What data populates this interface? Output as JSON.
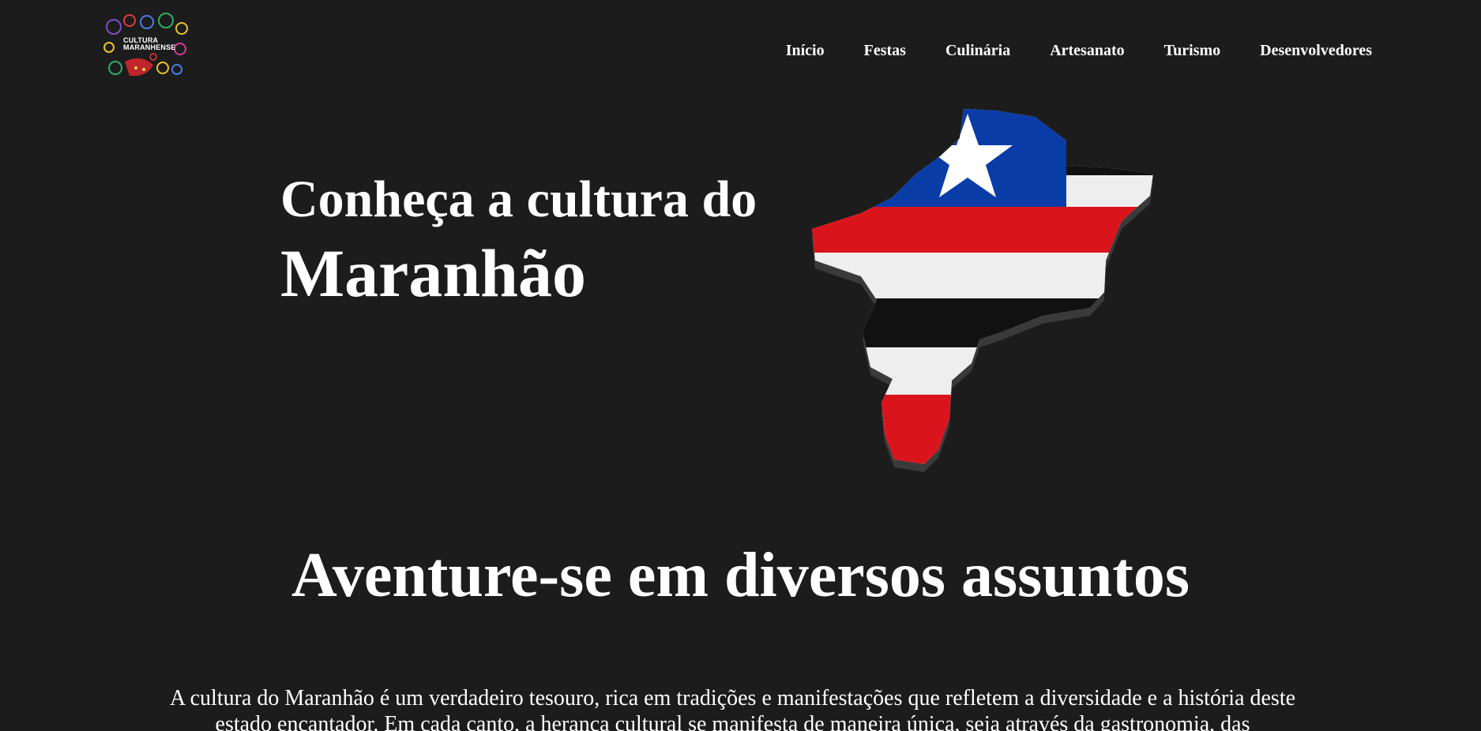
{
  "logo": {
    "line1": "CULTURA",
    "line2": "MARANHENSE"
  },
  "nav": {
    "items": [
      "Início",
      "Festas",
      "Culinária",
      "Artesanato",
      "Turismo",
      "Desenvolvedores"
    ]
  },
  "hero": {
    "line1": "Conheça a cultura do",
    "line2": "Maranhão",
    "image_icon": "maranhao-flag-map"
  },
  "section": {
    "title": "Aventure-se em diversos assuntos",
    "text": "A cultura do Maranhão é um verdadeiro tesouro, rica em tradições e manifestações que refletem a diversidade e a história deste estado encantador. Em cada canto, a herança cultural se manifesta de maneira única, seja através da gastronomia, das"
  },
  "colors": {
    "background": "#1c1c1d",
    "flag_blue": "#0a3ca8",
    "flag_red": "#d9141c",
    "flag_white": "#eeeeee",
    "flag_black": "#111111"
  }
}
